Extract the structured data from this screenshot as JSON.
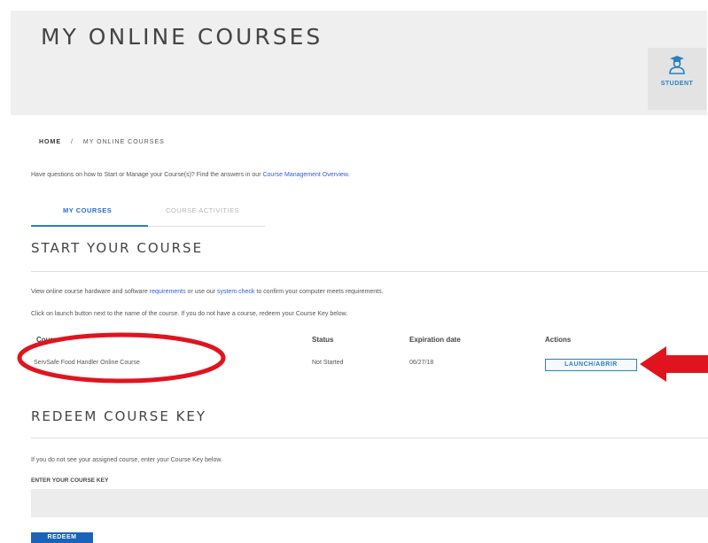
{
  "header": {
    "page_title": "MY ONLINE COURSES",
    "role_label": "STUDENT",
    "role_icon": "student-icon"
  },
  "breadcrumb": {
    "home": "HOME",
    "separator": "/",
    "current": "MY ONLINE COURSES"
  },
  "help": {
    "text": "Have questions on how to Start or Manage your Course(s)? Find the answers in our",
    "link": "Course Management Overview",
    "end": "."
  },
  "tabs": [
    {
      "label": "MY COURSES",
      "active": true
    },
    {
      "label": "COURSE ACTIVITIES",
      "active": false
    }
  ],
  "start_section": {
    "title": "START YOUR COURSE",
    "line1_a": "View online course hardware and software",
    "line1_link1": "requirements",
    "line1_b": "or use our",
    "line1_link2": "system check",
    "line1_c": "to confirm your computer meets requirements.",
    "line2": "Click on launch button next to the name of the course. If you do not have a course, redeem your Course Key below."
  },
  "table": {
    "headers": {
      "course": "Course",
      "status": "Status",
      "expiration": "Expiration date",
      "actions": "Actions"
    },
    "rows": [
      {
        "course": "ServSafe Food Handler Online Course",
        "status": "Not Started",
        "expiration": "06/27/18",
        "action": "LAUNCH/ABRIR"
      }
    ]
  },
  "redeem_section": {
    "title": "REDEEM COURSE KEY",
    "text": "If you do not see your assigned course, enter your Course Key below.",
    "input_label": "ENTER YOUR COURSE KEY",
    "input_value": "",
    "button": "REDEEM"
  },
  "annotations": {
    "circle_color": "#e0141e",
    "arrow_color": "#e0141e"
  },
  "colors": {
    "accent": "#2a7fc0",
    "link": "#2b5fd9",
    "header_bg": "#efefef"
  }
}
